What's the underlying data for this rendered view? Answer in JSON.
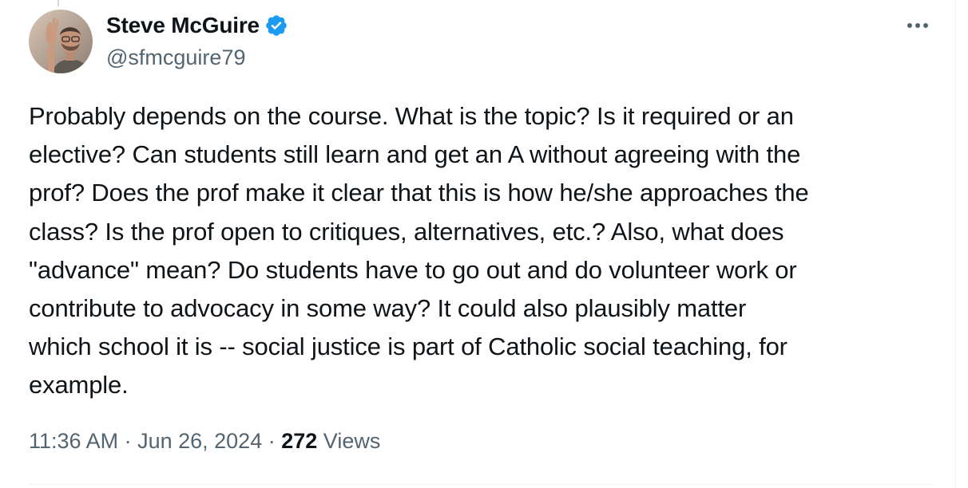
{
  "tweet": {
    "author": {
      "display_name": "Steve McGuire",
      "handle": "@sfmcguire79",
      "verified": true
    },
    "text": "Probably depends on the course. What is the topic? Is it required or an\nelective? Can students still learn and get an A without agreeing with the\nprof? Does the prof make it clear that this is how he/she approaches the\nclass? Is the prof open to critiques, alternatives, etc.? Also, what does\n\"advance\" mean? Do students have to go out and do volunteer work or\ncontribute to advocacy in some way? It could also plausibly matter\nwhich school it is -- social justice is part of Catholic social teaching, for\nexample.",
    "time": "11:36 AM",
    "separator": " · ",
    "date": "Jun 26, 2024",
    "views_count": "272",
    "views_label": "Views"
  },
  "colors": {
    "text_primary": "#0f1419",
    "text_secondary": "#536471",
    "verified_blue": "#1d9bf0",
    "divider": "#eff3f4"
  },
  "icons": {
    "verified": "verified-badge-icon",
    "more": "more-horizontal-icon"
  }
}
